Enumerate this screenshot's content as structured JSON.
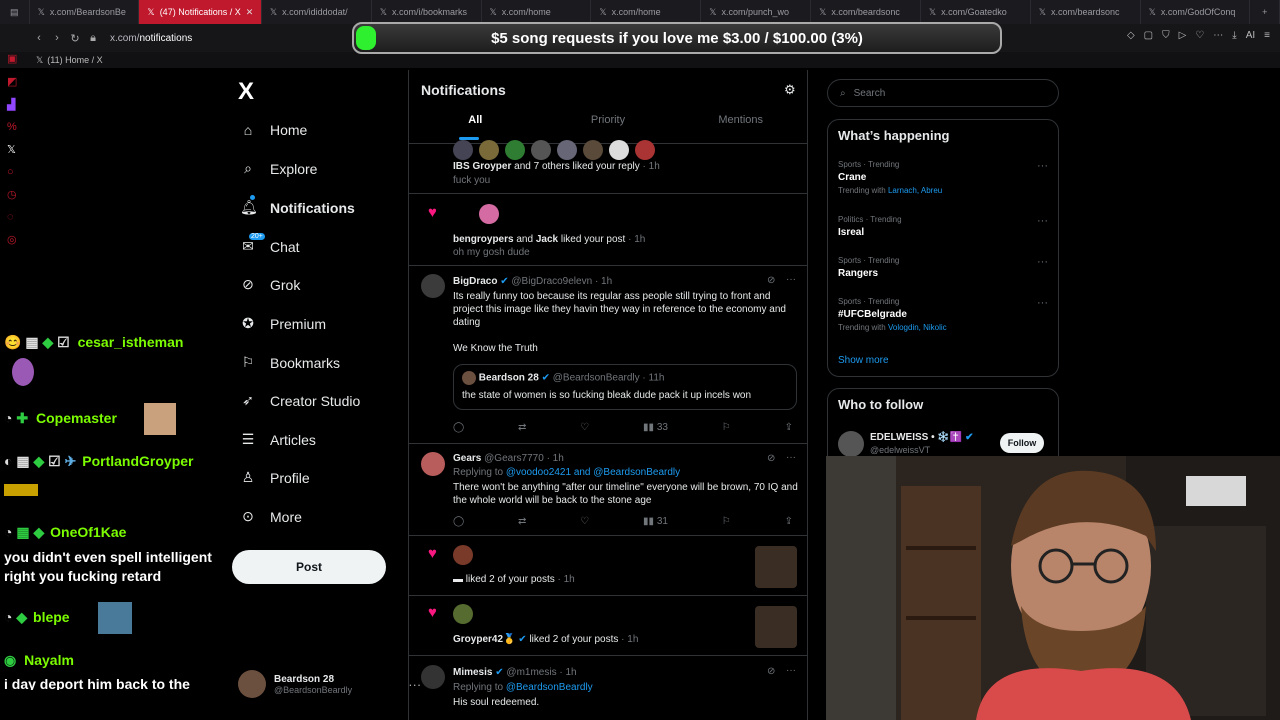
{
  "browser": {
    "tabs": [
      {
        "label": "x.com/BeardsonBe",
        "active": false
      },
      {
        "label": "(47) Notifications / X",
        "active": true
      },
      {
        "label": "x.com/ididdodat/",
        "active": false
      },
      {
        "label": "x.com/i/bookmarks",
        "active": false
      },
      {
        "label": "x.com/home",
        "active": false
      },
      {
        "label": "x.com/home",
        "active": false
      },
      {
        "label": "x.com/punch_wo",
        "active": false
      },
      {
        "label": "x.com/beardsonc",
        "active": false
      },
      {
        "label": "x.com/Goatedko",
        "active": false
      },
      {
        "label": "x.com/beardsonc",
        "active": false
      },
      {
        "label": "x.com/GodOfConq",
        "active": false
      }
    ],
    "url_host": "x.com/",
    "url_path": "notifications",
    "bookmark_label": "(11) Home / X"
  },
  "donation": {
    "text": "$5 song requests if you love me $3.00 / $100.00 (3%)",
    "progress": 0.03
  },
  "sidebar": {
    "logo": "X",
    "items": [
      {
        "label": "Home",
        "icon": "home-icon",
        "bold": false
      },
      {
        "label": "Explore",
        "icon": "search-icon",
        "bold": false
      },
      {
        "label": "Notifications",
        "icon": "bell-icon",
        "bold": true
      },
      {
        "label": "Chat",
        "icon": "chat-icon",
        "bold": false,
        "badge": "20+"
      },
      {
        "label": "Grok",
        "icon": "grok-icon",
        "bold": false
      },
      {
        "label": "Premium",
        "icon": "premium-icon",
        "bold": false
      },
      {
        "label": "Bookmarks",
        "icon": "bookmark-icon",
        "bold": false
      },
      {
        "label": "Creator Studio",
        "icon": "rocket-icon",
        "bold": false
      },
      {
        "label": "Articles",
        "icon": "articles-icon",
        "bold": false
      },
      {
        "label": "Profile",
        "icon": "profile-icon",
        "bold": false
      },
      {
        "label": "More",
        "icon": "more-icon",
        "bold": false
      }
    ],
    "post_label": "Post",
    "account_name": "Beardson 28",
    "account_handle": "@BeardsonBeardly"
  },
  "chat": [
    {
      "user": "cesar_istheman",
      "color": "#7cfc00"
    },
    {
      "user": "Copemaster",
      "color": "#7cfc00"
    },
    {
      "user": "PortlandGroyper",
      "color": "#7cfc00"
    },
    {
      "user": "OneOf1Kae",
      "color": "#7cfc00"
    },
    {
      "user": "",
      "message": "you didn't even spell intelligent right you fucking retard"
    },
    {
      "user": "blepe",
      "color": "#7cfc00"
    },
    {
      "user": "Nayalm",
      "color": "#7cfc00"
    },
    {
      "user": "",
      "message": "i day deport him back to the"
    }
  ],
  "notifications": {
    "title": "Notifications",
    "tabs": [
      "All",
      "Priority",
      "Mentions"
    ],
    "n1": {
      "who": "IBS Groyper",
      "rest": "and 7 others liked your reply",
      "time": "· 1h",
      "snippet": "fuck you"
    },
    "n2": {
      "who1": "bengroypers",
      "and": "and",
      "who2": "Jack",
      "rest": "liked your post",
      "time": "· 1h",
      "snippet": "oh my gosh dude"
    },
    "t1": {
      "name": "BigDraco",
      "handle": "@BigDraco9elevn",
      "time": "· 1h",
      "text": "Its really funny too because its regular ass people still trying to front and project this image like they havin they way in reference to the economy and dating",
      "text2": "We Know the Truth",
      "quote_name": "Beardson 28",
      "quote_handle": "@BeardsonBeardly",
      "quote_time": "· 11h",
      "quote_text": "the state of women is so fucking bleak dude pack it up incels won",
      "views": "33"
    },
    "t2": {
      "name": "Gears",
      "handle": "@Gears7770",
      "time": "· 1h",
      "replying": "Replying to",
      "reply_to1": "@voodoo2421",
      "reply_and": "and",
      "reply_to2": "@BeardsonBeardly",
      "text": "There won't be anything \"after our timeline\" everyone will be brown, 70 IQ and the whole world will be back to the stone age",
      "views": "31"
    },
    "n3": {
      "who": "▬",
      "rest": "liked 2 of your posts",
      "time": "· 1h"
    },
    "n4": {
      "who": "Groyper42🥇",
      "rest": "liked 2 of your posts",
      "time": "· 1h"
    },
    "t3": {
      "name": "Mimesis",
      "handle": "@m1mesis",
      "time": "· 1h",
      "replying": "Replying to",
      "reply_to": "@BeardsonBeardly",
      "text": "His soul redeemed."
    }
  },
  "right": {
    "search_placeholder": "Search",
    "happening_title": "What’s happening",
    "trends": [
      {
        "meta": "Sports · Trending",
        "topic": "Crane",
        "with_label": "Trending with",
        "with": "Larnach, Abreu"
      },
      {
        "meta": "Politics · Trending",
        "topic": "Isreal"
      },
      {
        "meta": "Sports · Trending",
        "topic": "Rangers"
      },
      {
        "meta": "Sports · Trending",
        "topic": "#UFCBelgrade",
        "with_label": "Trending with",
        "with": "Vologdin, Nikolic"
      }
    ],
    "show_more": "Show more",
    "follow_title": "Who to follow",
    "follow_name": "EDELWEISS • ❄️✝️",
    "follow_handle": "@edelweissVT",
    "follow_label": "Follow"
  },
  "colors": {
    "accent": "#1d9bf0",
    "like": "#f91880",
    "browser_active_tab": "#c0182c",
    "donation_bar": "#2ef02e"
  }
}
